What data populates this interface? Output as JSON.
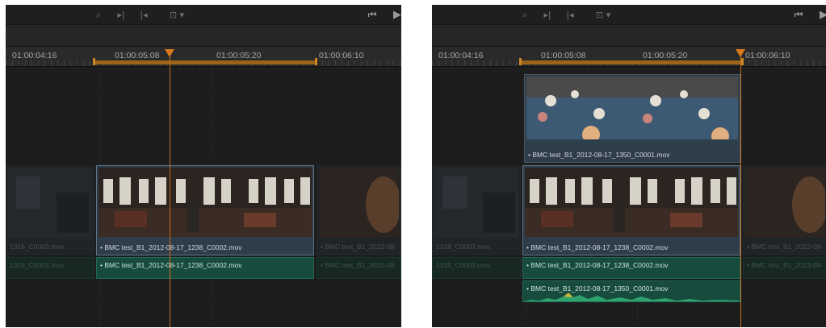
{
  "colors": {
    "accent": "#d8781f",
    "panel_bg": "#1c1c1c",
    "video_clip": "#2f3d4a",
    "audio_clip": "#174b3e",
    "waveform": "#2fa36e"
  },
  "icons": [
    "zoom-icon",
    "frame-forward-icon",
    "frame-back-icon",
    "clip-view-icon",
    "skip-to-start-icon",
    "play-icon",
    "selection-tool-icon",
    "trim-tool-icon",
    "blade-tool-icon",
    "insert-icon",
    "overwrite-icon",
    "replace-icon"
  ],
  "left": {
    "ruler": {
      "tc1": "01:00:04:16",
      "tc2": "01:00:05:08",
      "tc3": "01:00:05:20",
      "tc4": "01:00:06:10"
    },
    "clips": {
      "v_prev": "1316_C0003.mov",
      "v_main": "• BMC test_B1_2012-08-17_1238_C0002.mov",
      "v_next": "• BMC test_B1_2012-08-",
      "a_prev": "1316_C0003.mov",
      "a_main": "• BMC test_B1_2012-08-17_1238_C0002.mov",
      "a_next": "• BMC test_B1_2012-08-"
    }
  },
  "right": {
    "ruler": {
      "tc1": "01:00:04:16",
      "tc2": "01:00:05:08",
      "tc3": "01:00:05:20",
      "tc4": "01:00:06:10"
    },
    "clips": {
      "v2_main": "• BMC test_B1_2012-08-17_1350_C0001.mov",
      "v_prev": "1316_C0003.mov",
      "v_main": "• BMC test_B1_2012-08-17_1238_C0002.mov",
      "v_next": "• BMC test_B1_2012-08-",
      "a_prev": "1316_C0003.mov",
      "a_main": "• BMC test_B1_2012-08-17_1238_C0002.mov",
      "a_next": "• BMC test_B1_2013-08-",
      "a2_main": "• BMC test_B1_2012-08-17_1350_C0001.mov"
    }
  }
}
